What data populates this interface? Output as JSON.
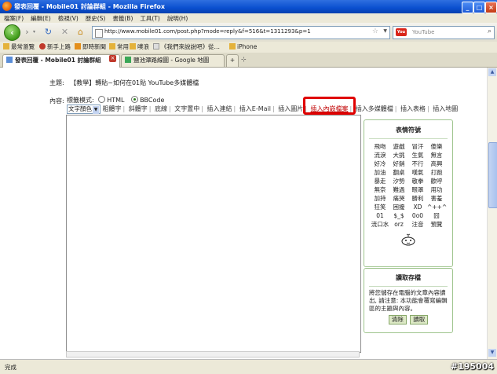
{
  "window": {
    "title": "發表回覆 - Mobile01 討論群組 - Mozilla Firefox",
    "min_label": "_",
    "max_label": "□",
    "close_label": "×"
  },
  "menu": [
    "檔案(F)",
    "編輯(E)",
    "檢視(V)",
    "歷史(S)",
    "書籤(B)",
    "工具(T)",
    "說明(H)"
  ],
  "nav": {
    "url": "http://www.mobile01.com/post.php?mode=reply&f=516&t=1311293&p=1",
    "search_placeholder": "YouTube",
    "search_engine_label": "You"
  },
  "bookmarks": [
    "最常瀏覽",
    "新手上路",
    "即時新聞",
    "常用",
    "噗浪",
    "《我們來說說吧》從…",
    "iPhone"
  ],
  "tabs": [
    {
      "label": "發表回覆 - Mobile01 討論群組",
      "active": true
    },
    {
      "label": "鹽池潭路線圖 - Google 地圖",
      "active": false
    }
  ],
  "new_tab_label": "+",
  "form": {
    "subject_label": "主題:",
    "subject_value": "【教學】轉貼~如何在01貼 YouTube多媒體檔",
    "content_label": "內容:",
    "mode_label": "標籤模式:",
    "html_option": "HTML",
    "bbcode_option": "BBCode",
    "color_select": "文字顏色",
    "toolbar": [
      "粗體字",
      "斜體字",
      "底線",
      "文字置中",
      "插入連結",
      "插入E-Mail",
      "插入圖片",
      "插入內嵌檔案",
      "插入多媒體檔",
      "插入表格",
      "插入地圖"
    ]
  },
  "emoticons": {
    "title": "表情符號",
    "rows": [
      [
        "飛吻",
        "遊戲",
        "冒汗",
        "傻樂"
      ],
      [
        "流淚",
        "大挑",
        "生氣",
        "無言"
      ],
      [
        "好冷",
        "好銷",
        "不行",
        "高興"
      ],
      [
        "加油",
        "翻桌",
        "嘆氣",
        "打跑"
      ],
      [
        "暴走",
        "汐勢",
        "敬拳",
        "歡呼"
      ],
      [
        "無奈",
        "難過",
        "眼罩",
        "用功"
      ],
      [
        "加持",
        "痛哭",
        "勝利",
        "害羞"
      ],
      [
        "狂笑",
        "困擾",
        "XD",
        "^++^"
      ],
      [
        "01",
        "$_$",
        "0o0",
        "囧"
      ],
      [
        "流口水",
        "orz",
        "注音",
        "預覽"
      ]
    ],
    "mascot_icon": "dudu-mascot-icon"
  },
  "draft": {
    "title": "讀取存檔",
    "description": "將您儲存在電腦的文章內容讀出, 請注意: 本功能會覆寫編輯區的主題與內容。",
    "clear_label": "清除",
    "load_label": "讀取"
  },
  "status": {
    "text": "完成",
    "watermark": "#195004"
  },
  "colors": {
    "highlight": "#e00000",
    "panel_border": "#9fc58e"
  }
}
